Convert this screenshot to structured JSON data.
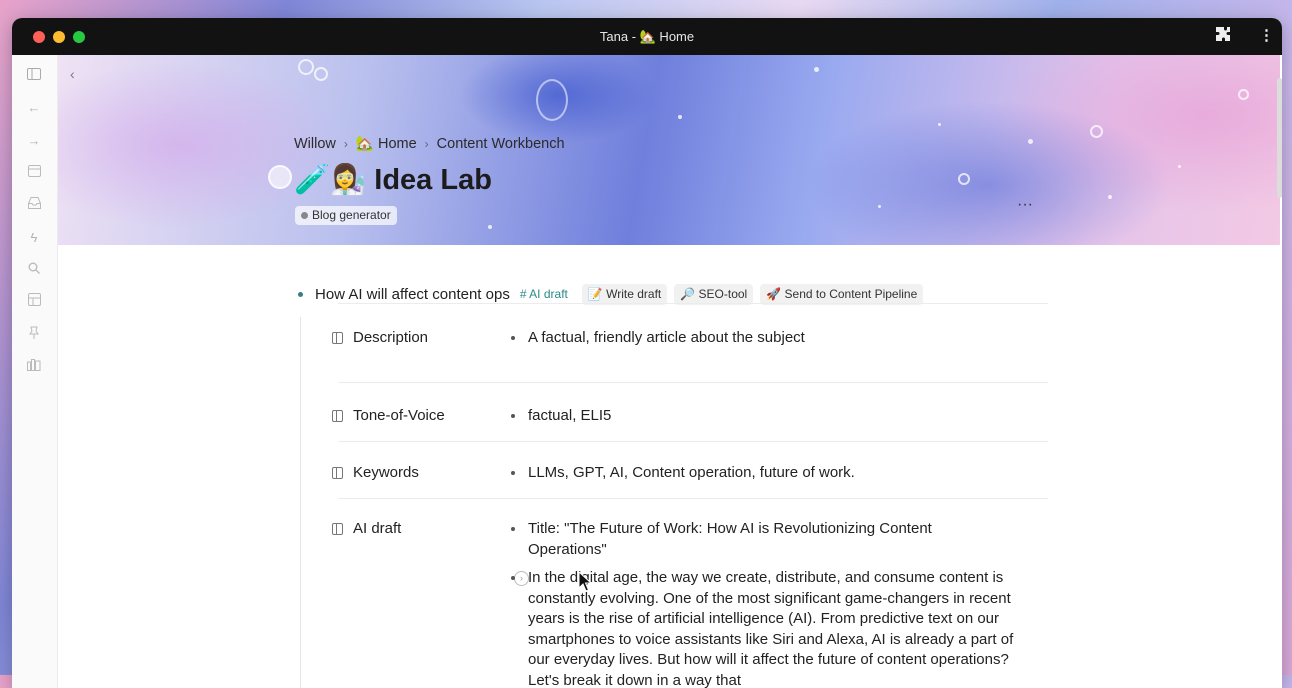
{
  "window": {
    "title": "Tana - 🏡 Home"
  },
  "sidebar": {
    "icons": [
      "panel-icon",
      "back-arrow-icon",
      "forward-arrow-icon",
      "calendar-icon",
      "inbox-icon",
      "lightning-icon",
      "search-icon",
      "layout-icon",
      "pin-icon",
      "library-icon"
    ]
  },
  "breadcrumb": {
    "items": [
      "Willow",
      "🏡 Home",
      "Content Workbench"
    ],
    "separator": "›"
  },
  "page": {
    "title": "🧪👩‍🔬 Idea Lab",
    "tag": "Blog generator",
    "more": "···"
  },
  "node": {
    "text": "How AI will affect content ops",
    "supertag": "# AI draft",
    "commands": [
      "📝 Write draft",
      "🔎 SEO-tool",
      "🚀 Send to Content Pipeline"
    ]
  },
  "fields": [
    {
      "label": "Description",
      "values": [
        "A factual, friendly article about the subject"
      ]
    },
    {
      "label": "Tone-of-Voice",
      "values": [
        "factual, ELI5"
      ]
    },
    {
      "label": "Keywords",
      "values": [
        "LLMs, GPT, AI, Content operation, future of work."
      ]
    },
    {
      "label": "AI draft",
      "values": [
        "Title: \"The Future of Work: How AI is Revolutionizing Content Operations\"",
        "In the digital age, the way we create, distribute, and consume content is constantly evolving. One of the most significant game-changers in recent years is the rise of artificial intelligence (AI). From predictive text on our smartphones to voice assistants like Siri and Alexa, AI is already a part of our everyday lives. But how will it affect the future of content operations? Let's break it down in a way that"
      ]
    }
  ],
  "colors": {
    "accent": "#3a7d88",
    "supertag": "#2a8a8a",
    "titlebar": "#121212"
  }
}
